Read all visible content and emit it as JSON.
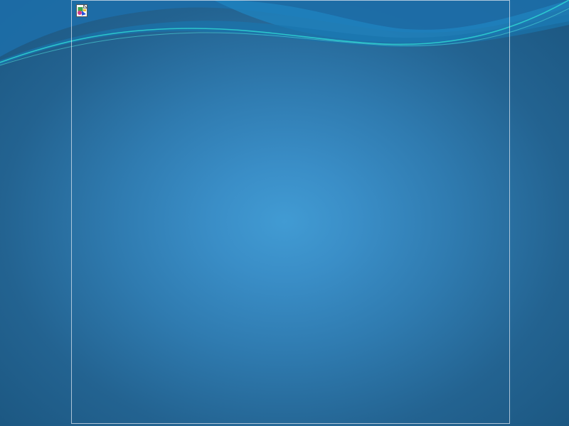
{
  "desktop": {
    "colors": {
      "background_center": "#419bd3",
      "background_edge": "#1b5680",
      "wave_dark": "#1d6ea8",
      "wave_mid": "#1f84c0",
      "wave_accent": "#2ecfd0",
      "frame_border": "#dce6f0"
    },
    "icon": {
      "name": "image-file-icon"
    }
  }
}
